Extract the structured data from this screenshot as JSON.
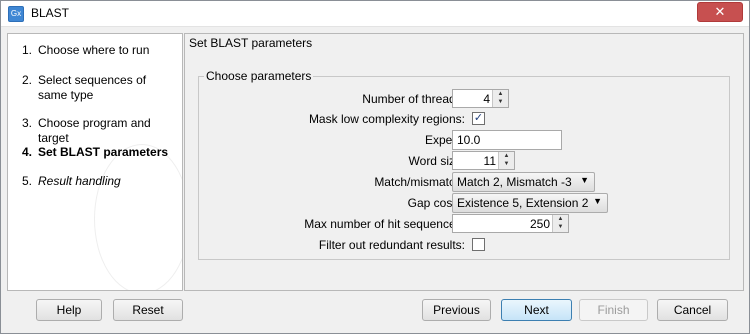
{
  "window": {
    "title": "BLAST",
    "icon_text": "Gx",
    "close_symbol": "✕"
  },
  "steps": [
    {
      "number": "1.",
      "label": "Choose where to run"
    },
    {
      "number": "2.",
      "label": "Select sequences of same type"
    },
    {
      "number": "3.",
      "label": "Choose program and target"
    },
    {
      "number": "4.",
      "label": "Set BLAST parameters"
    },
    {
      "number": "5.",
      "label": "Result handling"
    }
  ],
  "current_step": 4,
  "main": {
    "heading": "Set BLAST parameters",
    "group_title": "Choose parameters",
    "fields": {
      "threads": {
        "label": "Number of threads:",
        "value": "4"
      },
      "mask": {
        "label": "Mask low complexity regions:",
        "checked": true,
        "check_glyph": "✓"
      },
      "expect": {
        "label": "Expect:",
        "value": "10.0"
      },
      "word_size": {
        "label": "Word size:",
        "value": "11"
      },
      "match": {
        "label": "Match/mismatch:",
        "selected": "Match 2, Mismatch -3"
      },
      "gap": {
        "label": "Gap costs:",
        "selected": "Existence 5, Extension 2"
      },
      "max_hits": {
        "label": "Max number of hit sequences:",
        "value": "250"
      },
      "filter": {
        "label": "Filter out redundant results:",
        "checked": false
      }
    },
    "spin_arrows": {
      "up": "▲",
      "down": "▼"
    },
    "dropdown_arrow": "▼"
  },
  "buttons": {
    "help": "Help",
    "reset": "Reset",
    "previous": "Previous",
    "next": "Next",
    "finish": "Finish",
    "cancel": "Cancel"
  }
}
